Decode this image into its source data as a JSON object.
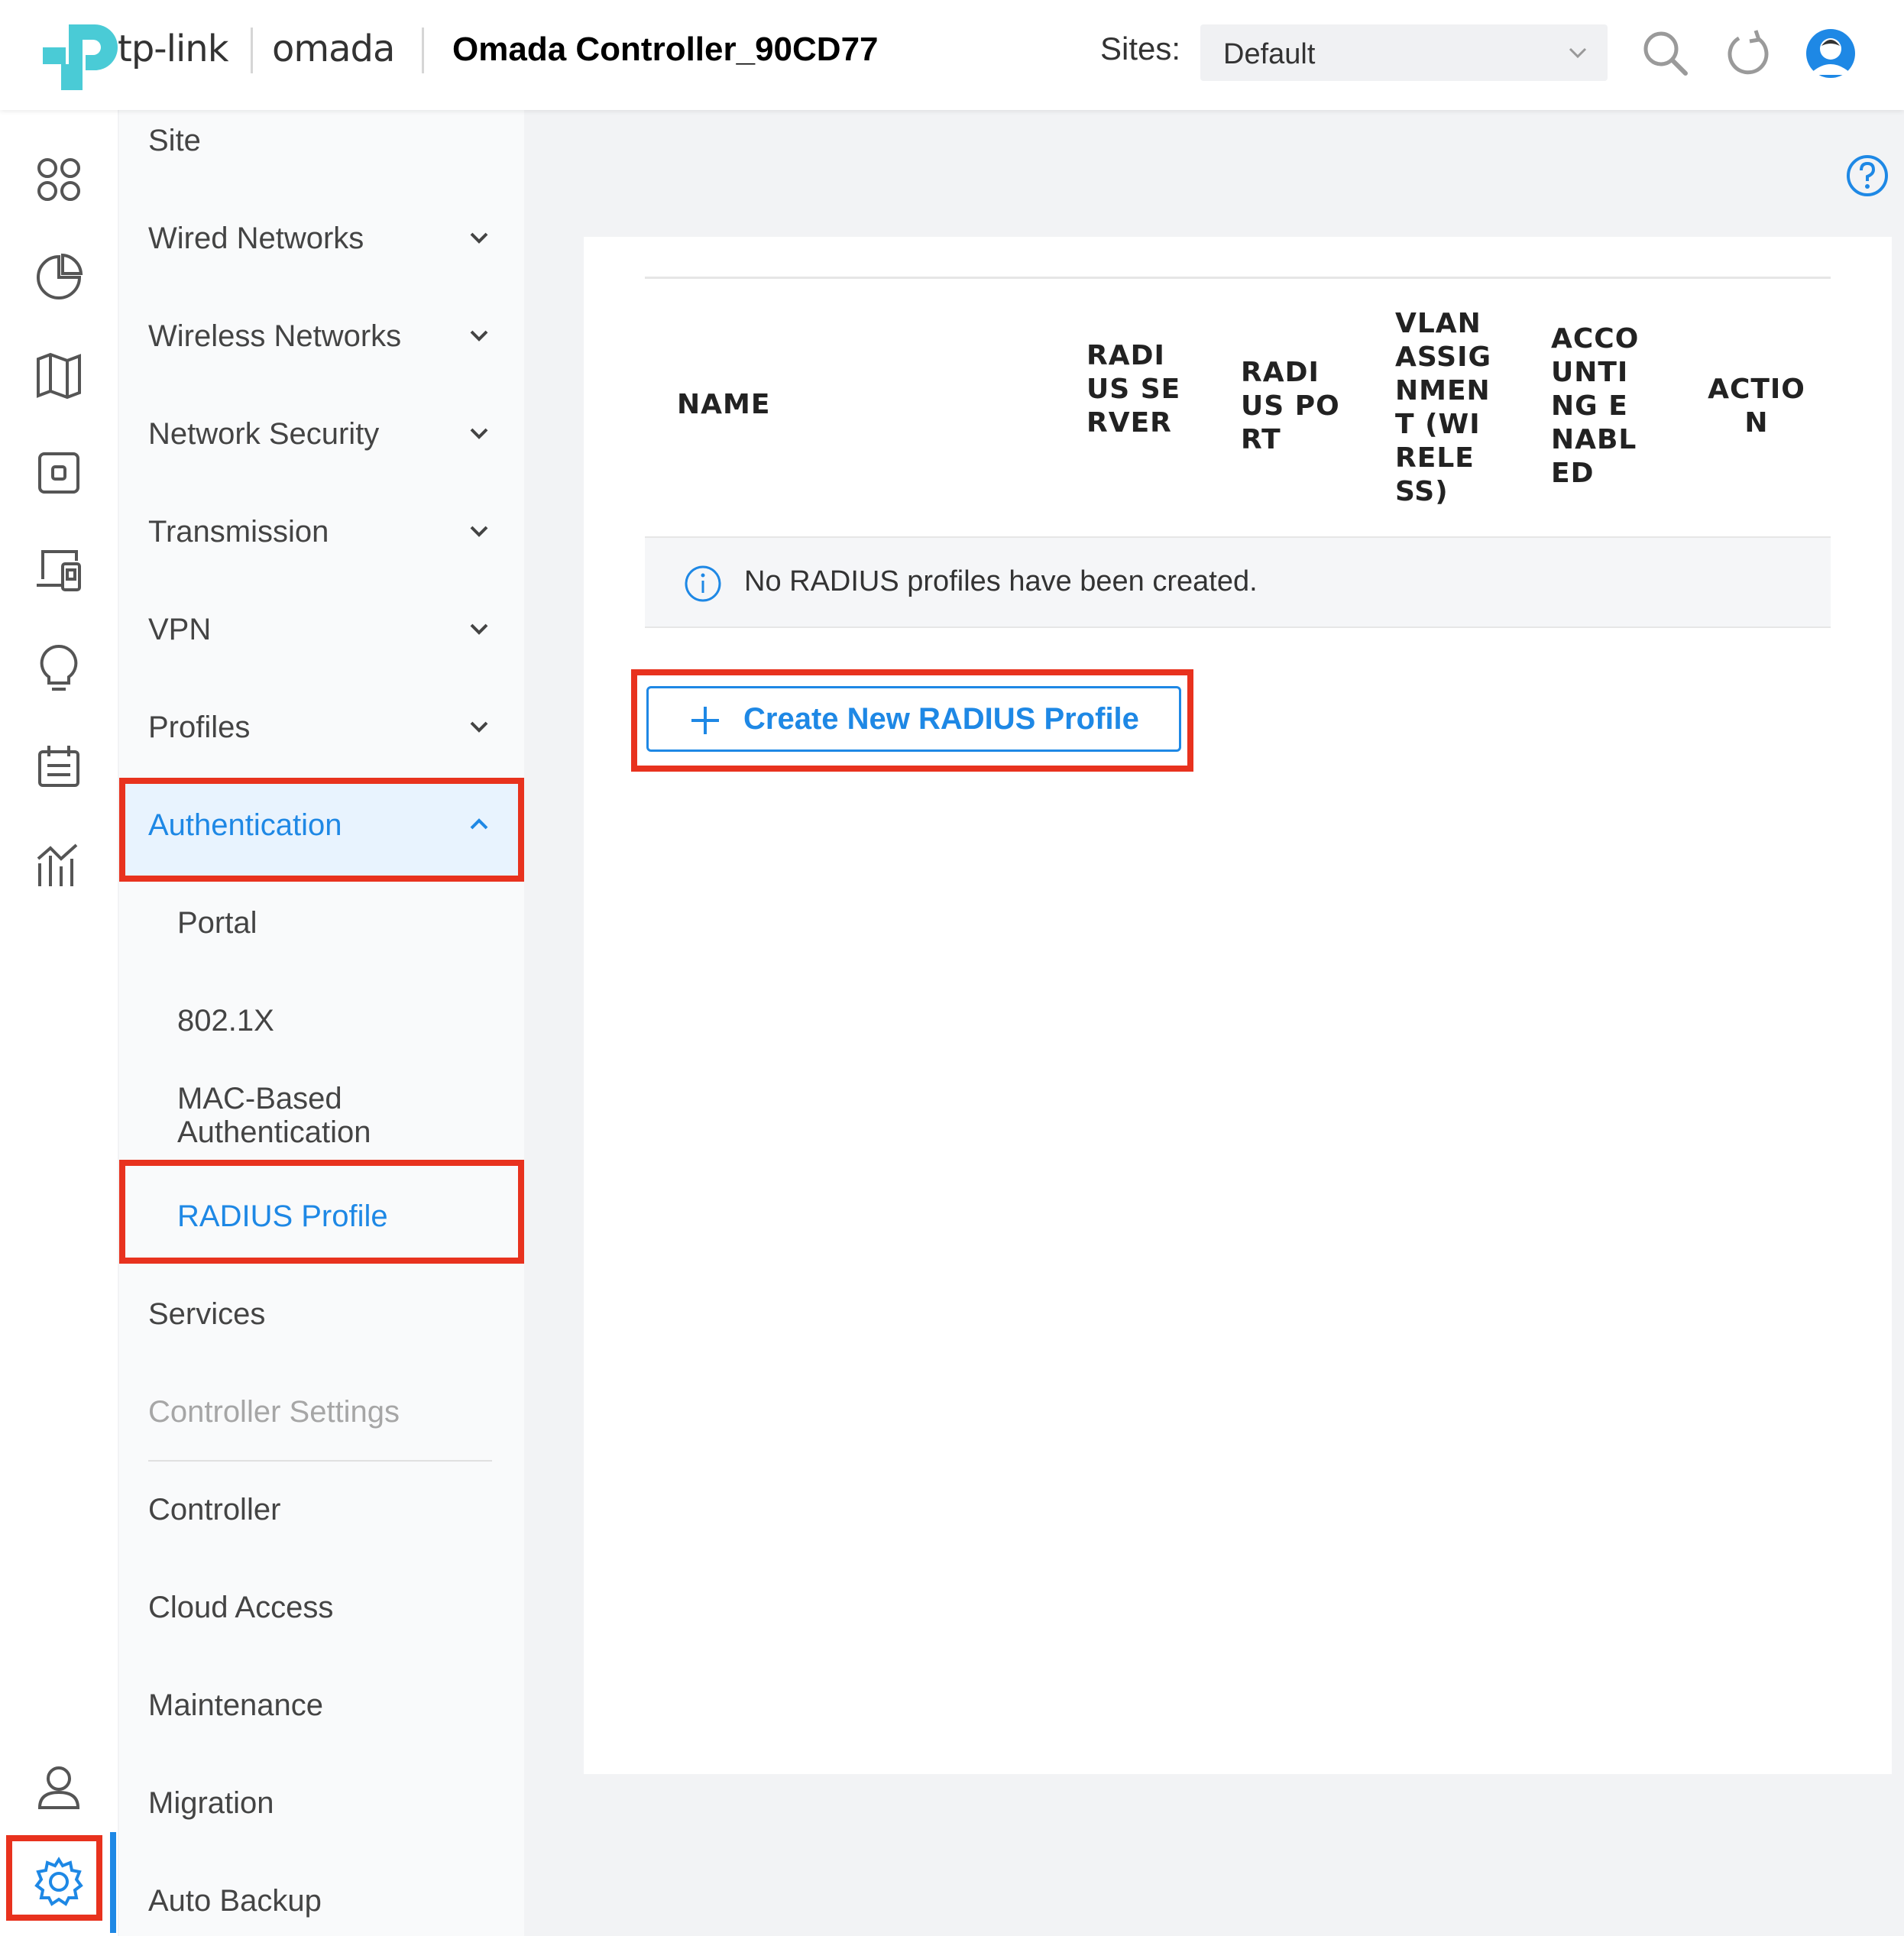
{
  "header": {
    "brand_tplink": "tp-link",
    "brand_omada": "omada",
    "controller_title": "Omada Controller_90CD77",
    "sites_label": "Sites:",
    "site_selected": "Default"
  },
  "rail": {
    "icons": [
      "dashboard-icon",
      "statistics-icon",
      "map-icon",
      "devices-icon",
      "clients-icon",
      "insight-icon",
      "log-icon",
      "reports-icon",
      "account-icon",
      "settings-icon"
    ],
    "active": "settings-icon"
  },
  "menu": {
    "site": "Site",
    "wired_networks": "Wired Networks",
    "wireless_networks": "Wireless Networks",
    "network_security": "Network Security",
    "transmission": "Transmission",
    "vpn": "VPN",
    "profiles": "Profiles",
    "authentication": "Authentication",
    "auth_items": [
      "Portal",
      "802.1X",
      "MAC-Based Authentication",
      "RADIUS Profile"
    ],
    "services": "Services",
    "controller_settings": "Controller Settings",
    "controller": "Controller",
    "cloud_access": "Cloud Access",
    "maintenance": "Maintenance",
    "migration": "Migration",
    "auto_backup": "Auto Backup"
  },
  "table": {
    "columns": [
      "NAME",
      "RADIUS SERVER",
      "RADIUS PORT",
      "VLAN ASSIGNMENT (WIRELESS)",
      "ACCOUNTING ENABLED",
      "ACTION"
    ],
    "empty_message": "No RADIUS profiles have been created."
  },
  "create_button": "Create New RADIUS Profile",
  "colors": {
    "accent": "#1e88e5",
    "highlight": "#e8321e",
    "logo_teal": "#4acbd6"
  }
}
